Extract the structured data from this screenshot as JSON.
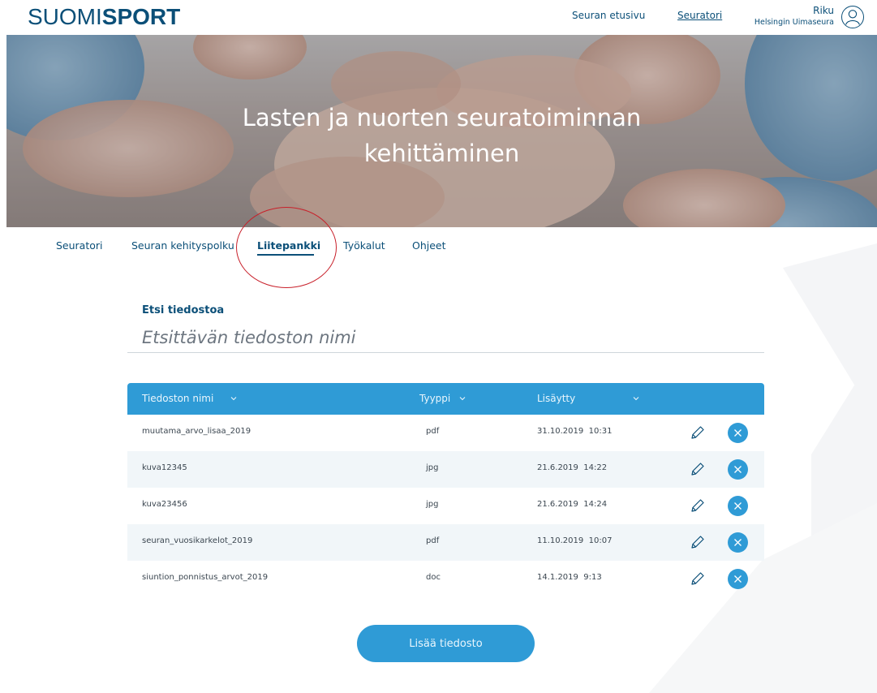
{
  "brand": {
    "logo_thin": "SUOMI",
    "logo_bold": "SPORT"
  },
  "top_nav": {
    "home": "Seuran etusivu",
    "seuratori": "Seuratori"
  },
  "user": {
    "name": "Riku",
    "club": "Helsingin Uimaseura"
  },
  "hero": {
    "line1": "Lasten ja nuorten seuratoiminnan",
    "line2": "kehittäminen"
  },
  "sub_nav": {
    "items": [
      "Seuratori",
      "Seuran kehityspolku",
      "Liitepankki",
      "Työkalut",
      "Ohjeet"
    ],
    "active": "Liitepankki"
  },
  "search": {
    "label": "Etsi tiedostoa",
    "placeholder": "Etsittävän tiedoston nimi"
  },
  "table": {
    "headers": {
      "name": "Tiedoston nimi",
      "type": "Tyyppi",
      "added": "Lisäytty"
    },
    "rows": [
      {
        "name": "muutama_arvo_lisaa_2019",
        "type": "pdf",
        "added": "31.10.2019  10:31"
      },
      {
        "name": "kuva12345",
        "type": "jpg",
        "added": "21.6.2019  14:22"
      },
      {
        "name": "kuva23456",
        "type": "jpg",
        "added": "21.6.2019  14:24"
      },
      {
        "name": "seuran_vuosikarkelot_2019",
        "type": "pdf",
        "added": "11.10.2019  10:07"
      },
      {
        "name": "siuntion_ponnistus_arvot_2019",
        "type": "doc",
        "added": "14.1.2019  9:13"
      }
    ]
  },
  "add_button": "Lisää tiedosto",
  "colors": {
    "primary": "#2f9bd6",
    "navy": "#0b4f78",
    "highlight": "#c8202a",
    "row_alt": "#f1f6f9"
  },
  "icons": [
    "user-avatar-icon",
    "chevron-down-icon",
    "pencil-icon",
    "close-icon"
  ]
}
